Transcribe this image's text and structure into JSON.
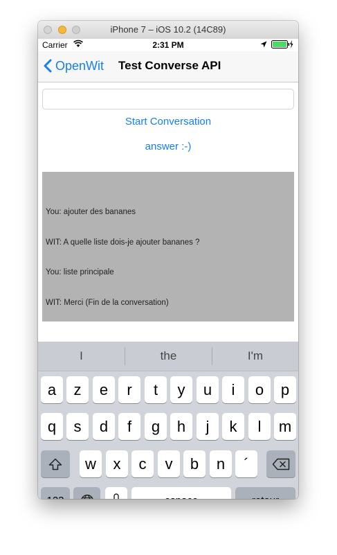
{
  "window": {
    "title": "iPhone 7 – iOS 10.2 (14C89)"
  },
  "status_bar": {
    "carrier": "Carrier",
    "time": "2:31 PM"
  },
  "nav": {
    "back_label": "OpenWit",
    "title": "Test Converse API"
  },
  "main": {
    "input_value": "",
    "start_button": "Start Conversation",
    "answer_button": "answer :-)",
    "log_lines": [
      "You: ajouter des bananes",
      "WIT: A quelle liste dois-je ajouter bananes ?",
      "You: liste principale",
      "WIT: Merci (Fin de la conversation)"
    ]
  },
  "keyboard": {
    "suggestions": [
      "I",
      "the",
      "I'm"
    ],
    "row1": [
      "a",
      "z",
      "e",
      "r",
      "t",
      "y",
      "u",
      "i",
      "o",
      "p"
    ],
    "row2": [
      "q",
      "s",
      "d",
      "f",
      "g",
      "h",
      "j",
      "k",
      "l",
      "m"
    ],
    "row3": [
      "w",
      "x",
      "c",
      "v",
      "b",
      "n",
      "´"
    ],
    "numbers_key": "123",
    "space_key": "espace",
    "return_key": "retour",
    "icons": {
      "shift": "shift-icon",
      "delete": "delete-icon",
      "globe": "globe-icon",
      "mic": "mic-icon"
    }
  },
  "colors": {
    "accent": "#147efb",
    "log_background": "#b3b3b3",
    "keyboard_background": "#d1d5db"
  }
}
